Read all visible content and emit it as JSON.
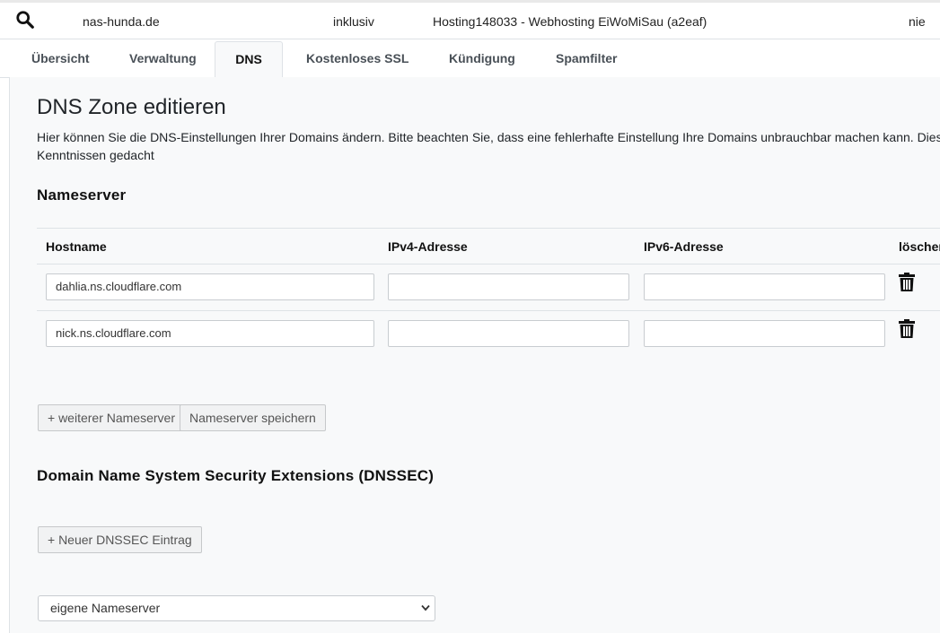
{
  "domain_row": {
    "domain": "nas-hunda.de",
    "status": "inklusiv",
    "package": "Hosting148033 - Webhosting EiWoMiSau (a2eaf)",
    "flag": "nie",
    "search_icon": "search-icon"
  },
  "tabs": [
    {
      "label": "Übersicht",
      "active": false
    },
    {
      "label": "Verwaltung",
      "active": false
    },
    {
      "label": "DNS",
      "active": true
    },
    {
      "label": "Kostenloses SSL",
      "active": false
    },
    {
      "label": "Kündigung",
      "active": false
    },
    {
      "label": "Spamfilter",
      "active": false
    }
  ],
  "main": {
    "title": "DNS Zone editieren",
    "intro_line1": "Hier können Sie die DNS-Einstellungen Ihrer Domains ändern. Bitte beachten Sie, dass eine fehlerhafte Einstellung Ihre Domains unbrauchbar machen kann. Dies",
    "intro_line2": "Kenntnissen gedacht",
    "nameserver": {
      "title": "Nameserver",
      "columns": [
        "Hostname",
        "IPv4-Adresse",
        "IPv6-Adresse",
        "löschen"
      ],
      "rows": [
        {
          "hostname": "dahlia.ns.cloudflare.com",
          "ipv4": "",
          "ipv6": "",
          "delete_icon": "trash-icon"
        },
        {
          "hostname": "nick.ns.cloudflare.com",
          "ipv4": "",
          "ipv6": "",
          "delete_icon": "trash-icon"
        }
      ],
      "add_button": "+ weiterer Nameserver",
      "save_button": "Nameserver speichern"
    },
    "dnssec": {
      "title": "Domain Name System Security Extensions (DNSSEC)",
      "add_button": "+ Neuer DNSSEC Eintrag"
    },
    "select": {
      "selected": "eigene Nameserver"
    }
  },
  "colors": {
    "panel_bg": "#f8f9fa",
    "border": "#dee2e6",
    "tab_text": "#495057",
    "button_bg": "#f1f2f3"
  }
}
